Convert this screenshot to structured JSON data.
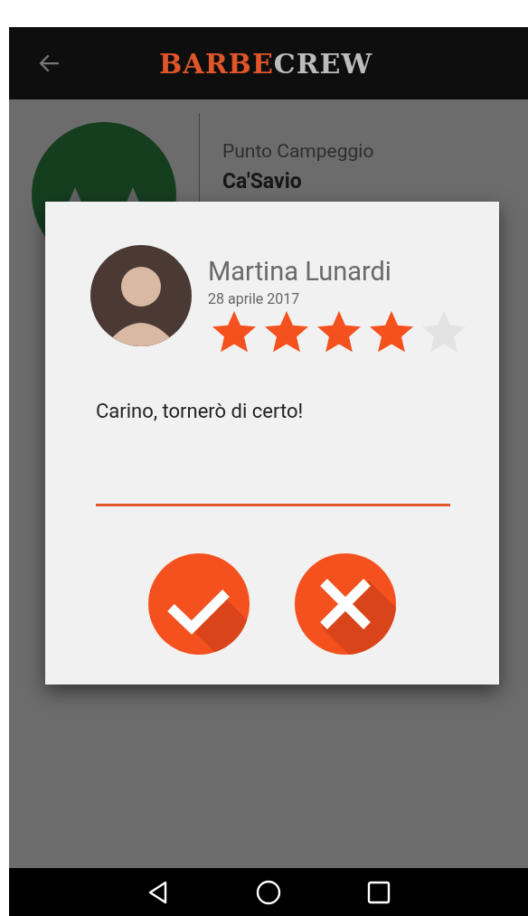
{
  "app_bar": {
    "logo": {
      "accent": "BARBE",
      "rest": "CREW"
    }
  },
  "place": {
    "category": "Punto Campeggio",
    "name": "Ca'Savio"
  },
  "review_dialog": {
    "author": "Martina Lunardi",
    "date": "28 aprile 2017",
    "stars": 4,
    "comment": "Carino, tornerò di certo!"
  }
}
